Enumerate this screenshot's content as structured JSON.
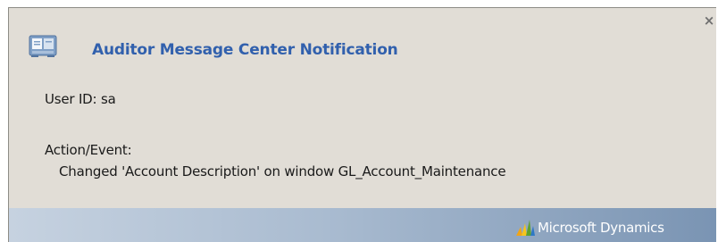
{
  "notification": {
    "close_glyph": "×",
    "icon": "message-window-icon",
    "title": "Auditor Message Center Notification",
    "user_line": "User ID: sa",
    "action_label": "Action/Event:",
    "action_detail": "Changed 'Account Description' on window GL_Account_Maintenance"
  },
  "footer": {
    "logo_icon": "microsoft-dynamics-logo",
    "brand": "Microsoft Dynamics"
  },
  "colors": {
    "panel_background": "#e1ddd6",
    "title_blue": "#3160ad",
    "footer_gradient_start": "#c6d2e0",
    "footer_gradient_end": "#7a94b3"
  }
}
